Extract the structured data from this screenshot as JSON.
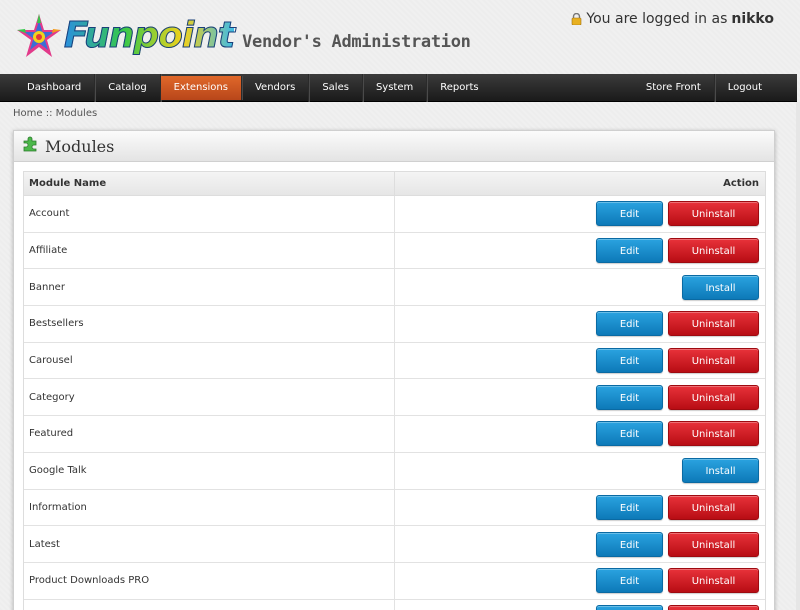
{
  "brand": {
    "name": "Funpoint",
    "subtitle": "Vendor's Administration"
  },
  "login": {
    "prefix": "You are logged in as",
    "user": "nikko"
  },
  "nav": {
    "left": [
      {
        "label": "Dashboard",
        "active": false
      },
      {
        "label": "Catalog",
        "active": false
      },
      {
        "label": "Extensions",
        "active": true
      },
      {
        "label": "Vendors",
        "active": false
      },
      {
        "label": "Sales",
        "active": false
      },
      {
        "label": "System",
        "active": false
      },
      {
        "label": "Reports",
        "active": false
      }
    ],
    "right": [
      {
        "label": "Store Front"
      },
      {
        "label": "Logout"
      }
    ]
  },
  "breadcrumb": "Home :: Modules",
  "panel": {
    "title": "Modules"
  },
  "table": {
    "col_name": "Module Name",
    "col_action": "Action",
    "rows": [
      {
        "name": "Account",
        "installed": true
      },
      {
        "name": "Affiliate",
        "installed": true
      },
      {
        "name": "Banner",
        "installed": false
      },
      {
        "name": "Bestsellers",
        "installed": true
      },
      {
        "name": "Carousel",
        "installed": true
      },
      {
        "name": "Category",
        "installed": true
      },
      {
        "name": "Featured",
        "installed": true
      },
      {
        "name": "Google Talk",
        "installed": false
      },
      {
        "name": "Information",
        "installed": true
      },
      {
        "name": "Latest",
        "installed": true
      },
      {
        "name": "Product Downloads PRO",
        "installed": true
      },
      {
        "name": "",
        "installed": true
      }
    ]
  },
  "buttons": {
    "edit": "Edit",
    "uninstall": "Uninstall",
    "install": "Install"
  },
  "colors": {
    "nav_active": "#d25a22",
    "edit_blue": "#1a8fd0",
    "uninstall_red": "#d0161e"
  },
  "icons": {
    "logo": "star-logo-icon",
    "lock": "lock-icon",
    "panel": "puzzle-icon"
  }
}
